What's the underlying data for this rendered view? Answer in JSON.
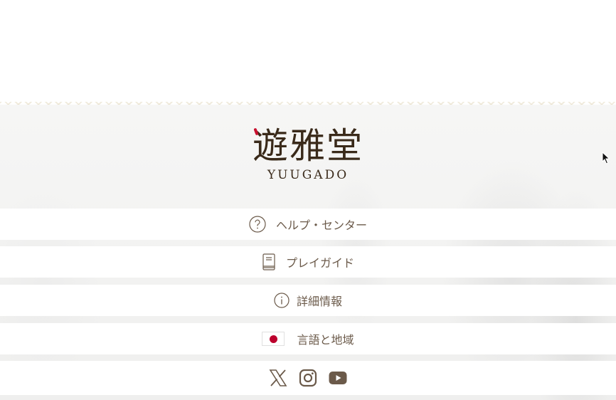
{
  "logo": {
    "kanji": "遊雅堂",
    "roman": "YUUGADO"
  },
  "menu": {
    "help": {
      "label": "ヘルプ・センター",
      "icon": "question-circle-icon"
    },
    "guide": {
      "label": "プレイガイド",
      "icon": "book-icon"
    },
    "info": {
      "label": "詳細情報",
      "icon": "info-circle-icon"
    },
    "language": {
      "label": "言語と地域",
      "icon": "japan-flag-icon"
    }
  },
  "social": [
    "x-icon",
    "instagram-icon",
    "youtube-icon"
  ],
  "colors": {
    "text": "#6b5a4a",
    "logo": "#3a2a1a",
    "accent": "#c8102e",
    "flag_red": "#bc002d"
  }
}
